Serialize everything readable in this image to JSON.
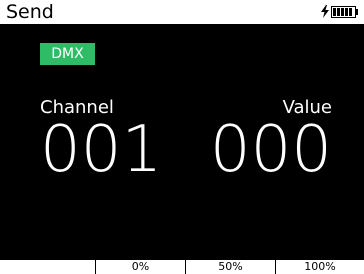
{
  "header": {
    "title": "Send",
    "status_icons": [
      "charging-bolt-icon",
      "battery-icon"
    ],
    "battery_level": 1.0
  },
  "mode": {
    "label": "DMX",
    "color": "#2ebd66"
  },
  "fields": {
    "channel": {
      "label": "Channel",
      "value": "001"
    },
    "value": {
      "label": "Value",
      "value": "000"
    }
  },
  "footer": {
    "items": [
      "",
      "0%",
      "50%",
      "100%"
    ]
  }
}
